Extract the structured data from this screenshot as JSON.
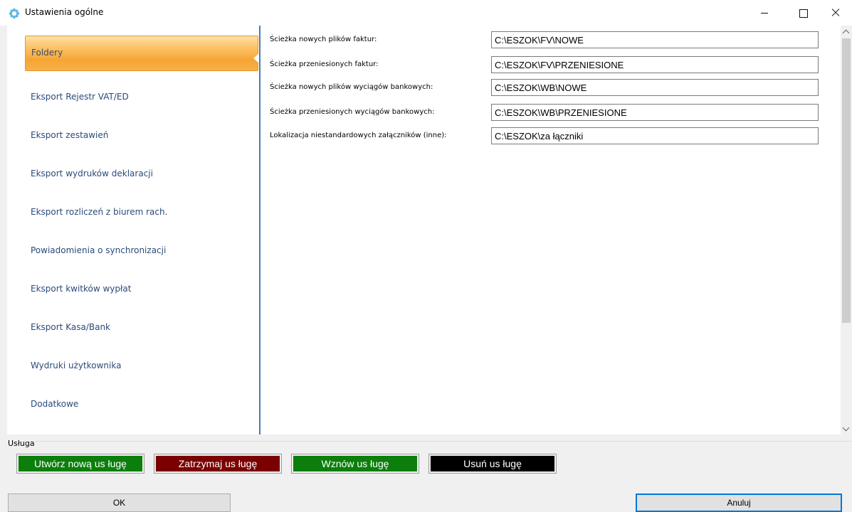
{
  "window": {
    "title": "Ustawienia ogólne",
    "icon": "gear-flower-icon"
  },
  "sidebar": {
    "items": [
      {
        "label": "Foldery",
        "active": true
      },
      {
        "label": "Eksport Rejestr VAT/ED"
      },
      {
        "label": "Eksport zestawień"
      },
      {
        "label": "Eksport wydruków deklaracji"
      },
      {
        "label": "Eksport rozliczeń z biurem rach."
      },
      {
        "label": "Powiadomienia o synchronizacji"
      },
      {
        "label": "Eksport kwitków wypłat"
      },
      {
        "label": "Eksport Kasa/Bank"
      },
      {
        "label": "Wydruki użytkownika"
      },
      {
        "label": "Dodatkowe"
      }
    ]
  },
  "fields": [
    {
      "label": "Ścieżka nowych plików faktur:",
      "value": "C:\\ESZOK\\FV\\NOWE"
    },
    {
      "label": "Ścieżka przeniesionych faktur:",
      "value": "C:\\ESZOK\\FV\\PRZENIESIONE"
    },
    {
      "label": "Ścieżka nowych plików wyciągów bankowych:",
      "value": "C:\\ESZOK\\WB\\NOWE"
    },
    {
      "label": "Ścieżka przeniesionych wyciągów bankowych:",
      "value": "C:\\ESZOK\\WB\\PRZENIESIONE"
    },
    {
      "label": "Lokalizacja niestandardowych załączników (inne):",
      "value": "C:\\ESZOK\\za łączniki"
    }
  ],
  "service": {
    "legend": "Usługa",
    "create": "Utwórz nową us ługę",
    "stop": "Zatrzymaj us ługę",
    "resume": "Wznów us ługę",
    "delete": "Usuń us ługę",
    "colors": {
      "green": "#0b7e0b",
      "red": "#7b0000",
      "black": "#000000"
    }
  },
  "dialog": {
    "ok": "OK",
    "cancel": "Anuluj"
  },
  "accent": {
    "sidebar_active": "#f6a534",
    "divider": "#4a79b6",
    "focus": "#0078d7"
  }
}
